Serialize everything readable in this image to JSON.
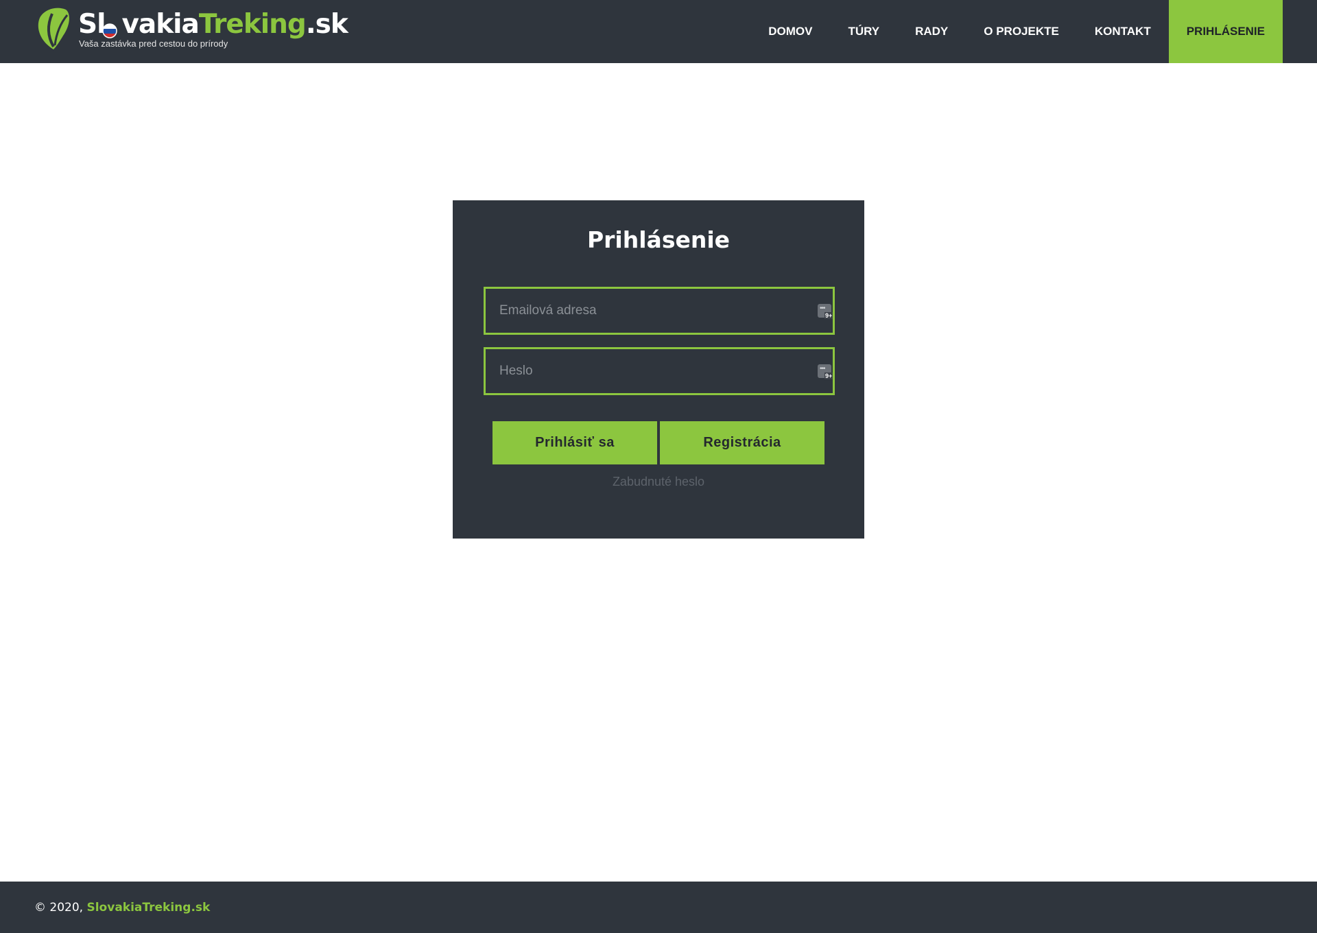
{
  "header": {
    "logo": {
      "name_part1": "Sl",
      "name_part2": "vakia",
      "name_part3": "Treking",
      "name_part4": ".sk",
      "tagline": "Vaša zastávka pred cestou do prírody"
    },
    "nav": [
      {
        "label": "DOMOV"
      },
      {
        "label": "TÚRY"
      },
      {
        "label": "RADY"
      },
      {
        "label": "O PROJEKTE"
      },
      {
        "label": "KONTAKT"
      },
      {
        "label": "PRIHLÁSENIE",
        "active": true
      }
    ]
  },
  "login": {
    "title": "Prihlásenie",
    "email_placeholder": "Emailová adresa",
    "email_value": "",
    "password_placeholder": "Heslo",
    "password_value": "",
    "password_manager_badge": "9+",
    "login_button": "Prihlásiť sa",
    "register_button": "Registrácia",
    "forgot_link": "Zabudnuté heslo"
  },
  "footer": {
    "copyright": "© 2020, ",
    "site_link": "SlovakiaTreking.sk"
  },
  "colors": {
    "dark_bg": "#2f353d",
    "accent_green": "#8cc63f",
    "page_bg": "#ffffff"
  }
}
